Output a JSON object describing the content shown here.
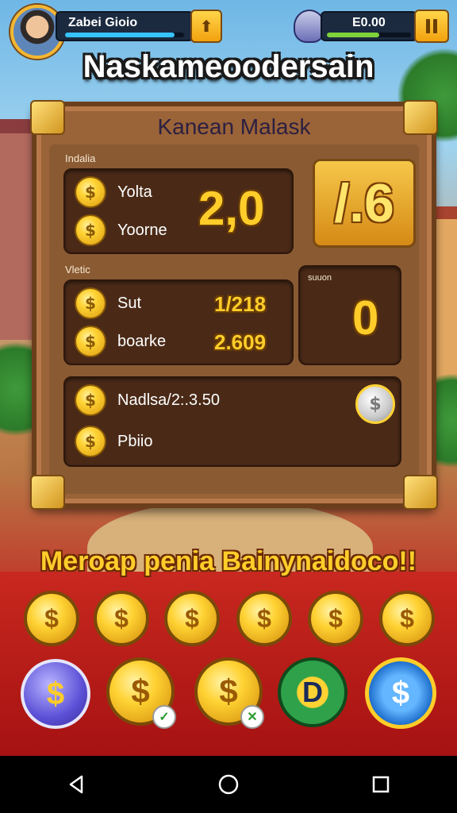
{
  "player": {
    "name": "Zabei Gioio",
    "xp_progress": 0.92
  },
  "hud": {
    "cash": "E0.00",
    "cash_progress": 0.62,
    "upgrade_icon": "arrow-up-icon",
    "pause_icon": "pause-icon"
  },
  "title": "Naskameoodersain",
  "panel": {
    "title": "Kanean Malask",
    "section1": {
      "label": "Indalia",
      "rows": [
        {
          "label": "Yolta"
        },
        {
          "label": "Yoorne"
        }
      ],
      "value": "2,0",
      "badge": "/.6"
    },
    "section2": {
      "label": "Vletic",
      "rows": [
        {
          "label": "Sut",
          "value": "1/218"
        },
        {
          "label": "boarke",
          "value": "2.609"
        }
      ],
      "side_label": "suuon",
      "side_value": "0"
    },
    "section3": {
      "rows": [
        {
          "label": "Nadlsa/2:.3.50"
        },
        {
          "label": "Pbiio"
        }
      ],
      "silver_symbol": "$"
    }
  },
  "promo": "Meroap penia Bainynaidoco!!",
  "coin_symbol": "$",
  "special_coins": [
    {
      "symbol": "$",
      "kind": "purple"
    },
    {
      "symbol": "$",
      "kind": "gold",
      "badge": "✓"
    },
    {
      "symbol": "$",
      "kind": "gold",
      "badge": "✕"
    },
    {
      "symbol": "D",
      "kind": "green"
    },
    {
      "symbol": "$",
      "kind": "blue"
    }
  ],
  "colors": {
    "gold": "#ffcd2a",
    "wood": "#9a6338",
    "dark_wood": "#4a2a17",
    "hud_bg": "#1b2a3f"
  },
  "nav": {
    "back_icon": "back-icon",
    "home_icon": "home-icon",
    "recents_icon": "recents-icon"
  }
}
